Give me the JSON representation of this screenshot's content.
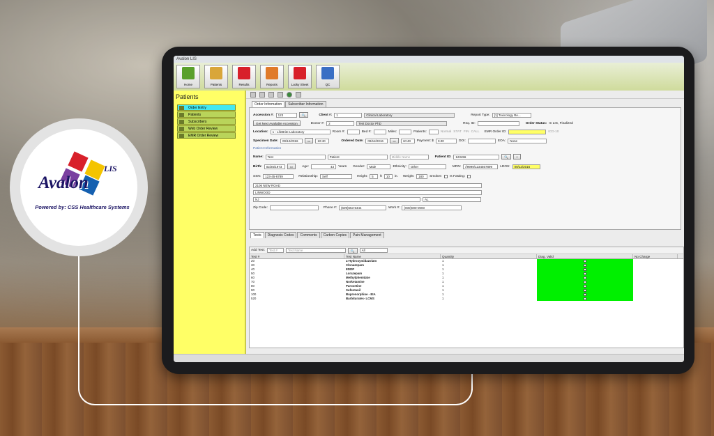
{
  "app": {
    "window_title": "Avalon LIS"
  },
  "logo": {
    "word": "Avalon",
    "superscript": "LIS",
    "tagline": "Powered by: CSS Healthcare Systems",
    "colors": {
      "red": "#d8202a",
      "yellow": "#f4c400",
      "blue": "#1560b0",
      "purple": "#7b3fa0"
    }
  },
  "toolbar": {
    "buttons": [
      {
        "label": "Home",
        "icon": "home-icon"
      },
      {
        "label": "Patients",
        "icon": "patients-icon"
      },
      {
        "label": "Results",
        "icon": "results-icon"
      },
      {
        "label": "Reports",
        "icon": "reports-icon"
      },
      {
        "label": "Lucky Sheet",
        "icon": "first-aid-icon"
      },
      {
        "label": "QC",
        "icon": "chart-icon"
      }
    ]
  },
  "sidebar": {
    "title": "Patients",
    "items": [
      {
        "label": "Order Entry",
        "active": true
      },
      {
        "label": "Patients"
      },
      {
        "label": "Subscribers"
      },
      {
        "label": "Web Order Review"
      },
      {
        "label": "EMR Order Review"
      }
    ]
  },
  "tabs": [
    "Order Information",
    "Subscriber Information"
  ],
  "form": {
    "accession_label": "Accession #:",
    "accession": "123",
    "client_label": "Client #:",
    "client": "1",
    "client_name": "Clinical Laboratory",
    "report_type_label": "Report Type:",
    "report_type": "[1] Toxicology Re...",
    "next_accession_btn": "Get Next Available Accession",
    "doctor_label": "Doctor #:",
    "doctor": "2",
    "doctor_name": "Test Doctor PhD",
    "req_id_label": "Req. ID:",
    "order_status_label": "Order Status:",
    "order_status": "In LIS, Finalized",
    "location_label": "Location:",
    "location": "1 - LifeBrite Laboratory",
    "room_label": "Room #:",
    "bed_label": "Bed #:",
    "miles_label": "Miles:",
    "patients_label": "Patients:",
    "priority": [
      "Normal",
      "STAT",
      "FIN",
      "CALL"
    ],
    "emr_label": "EMR Order ID:",
    "emr_extra": "ICD-10",
    "specimen_date_label": "Specimen Date:",
    "specimen_date": "09/12/2016",
    "specimen_time": "10:40",
    "ordered_date_label": "Ordered Date:",
    "ordered_date": "09/12/2016",
    "ordered_time": "10:40",
    "payment_label": "Payment: $",
    "payment": "0.00",
    "doi_label": "DOI:",
    "eoa_label": "EOA:",
    "eoa": "None",
    "patient_info_label": "Patient Information",
    "name_label": "Name:",
    "first_name": "Test",
    "last_name": "Patient",
    "middle_placeholder": "Middle Name",
    "patient_id_label": "Patient ID:",
    "patient_id": "123456",
    "birth_label": "Birth:",
    "birth": "02/25/1973",
    "age_label": "Age:",
    "age": "43",
    "years_label": "Years",
    "gender_label": "Gender:",
    "gender": "Male",
    "ethnicity_label": "Ethnicity:",
    "ethnicity": "Other",
    "mrn_label": "MRN:",
    "mrn": "//9999/1234567899",
    "ldos_label": "LDOS:",
    "ldos": "09/12/2016",
    "ssn_label": "SSN:",
    "ssn": "123-45-6789",
    "relationship_label": "Relationship:",
    "relationship": "Self",
    "height_label": "Height:",
    "height_ft": "5",
    "ft_label": "ft",
    "height_in": "10",
    "in_label": "in.",
    "weight_label": "Weight:",
    "weight": "180",
    "smoker_label": "Smoker:",
    "fasting_label": "Is Fasting:",
    "address1": "2106 NEW ROAD",
    "city": "LINWOOD",
    "state": "NJ",
    "state2": "AL",
    "zip_label": "Zip Code:",
    "phone_label": "Phone #:",
    "phone": "(609)653-6444",
    "work_label": "Work #:",
    "work": "(000)000-0000"
  },
  "subtabs": [
    "Tests",
    "Diagnosis Codes",
    "Comments",
    "Carbon Copies",
    "Pain Management"
  ],
  "tests": {
    "add_label": "Add Test:",
    "test_placeholder": "Test #",
    "name_placeholder": "Test Name",
    "filter": "All",
    "columns": [
      "Test #",
      "Test Name",
      "Quantity",
      "Diag. Valid",
      "No Charge"
    ],
    "rows": [
      {
        "num": "20",
        "name": "a-Hydroxymidazolam",
        "qty": "1"
      },
      {
        "num": "30",
        "name": "Clonazepam",
        "qty": "1"
      },
      {
        "num": "40",
        "name": "EDDP",
        "qty": "1"
      },
      {
        "num": "50",
        "name": "Lorazepam",
        "qty": "1"
      },
      {
        "num": "60",
        "name": "Methylphenidate",
        "qty": "1"
      },
      {
        "num": "70",
        "name": "Norketamine",
        "qty": "1"
      },
      {
        "num": "80",
        "name": "Paroxetine",
        "qty": "1"
      },
      {
        "num": "90",
        "name": "Sufentanil",
        "qty": "1"
      },
      {
        "num": "100",
        "name": "Buprenorphine - EIA",
        "qty": "1"
      },
      {
        "num": "520",
        "name": "Barbiturates- LCMS",
        "qty": "1"
      }
    ]
  }
}
